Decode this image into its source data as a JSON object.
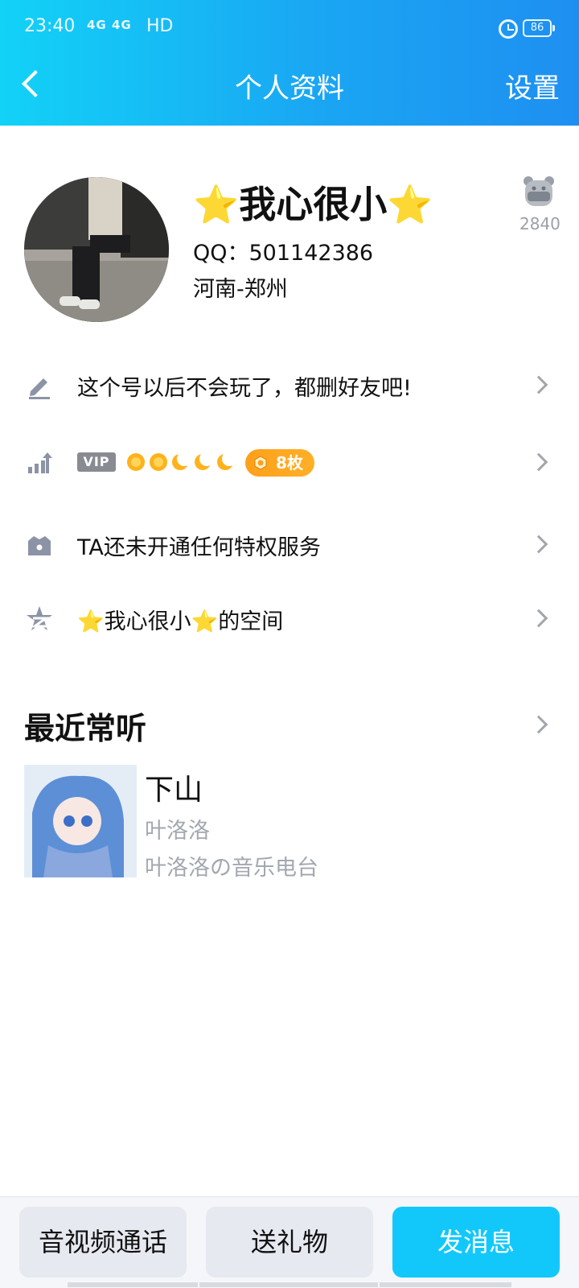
{
  "status_bar": {
    "time": "23:40",
    "network": "4G 4G",
    "hd": "HD",
    "battery": "86"
  },
  "nav": {
    "title": "个人资料",
    "settings": "设置"
  },
  "profile": {
    "nickname": "⭐我心很小⭐",
    "qq": "QQ：501142386",
    "location": "河南-郑州",
    "badge_icon": "bear-level-icon",
    "level_number": "2840"
  },
  "rows": {
    "signature": "这个号以后不会玩了，都删好友吧!",
    "vip_badge": "VIP",
    "medal_count": "8枚",
    "privilege": "TA还未开通任何特权服务",
    "space": "⭐我心很小⭐的空间"
  },
  "recent": {
    "title": "最近常听",
    "song_title": "下山",
    "artist": "叶洛洛",
    "radio": "叶洛洛の音乐电台"
  },
  "bottom": {
    "call": "音视频通话",
    "gift": "送礼物",
    "message": "发消息"
  },
  "colors": {
    "accent": "#12c8fb",
    "header_start": "#12d2f7",
    "header_end": "#1e8ff1",
    "medal": "#ff9f1a",
    "muted": "#a3a8b0"
  }
}
